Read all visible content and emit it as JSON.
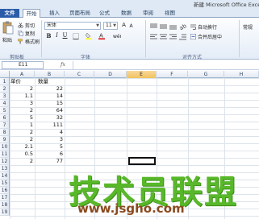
{
  "window": {
    "title": "新建 Microsoft Office Exce"
  },
  "tabs": [
    {
      "label": "文件"
    },
    {
      "label": "开始"
    },
    {
      "label": "插入"
    },
    {
      "label": "页面布局"
    },
    {
      "label": "公式"
    },
    {
      "label": "数据"
    },
    {
      "label": "审阅"
    },
    {
      "label": "视图"
    }
  ],
  "ribbon": {
    "clipboard": {
      "paste": "粘贴",
      "cut": "剪切",
      "copy": "复制",
      "format_painter": "格式刷",
      "group_label": "剪贴板"
    },
    "font": {
      "font_name": "宋体",
      "font_size": "11",
      "bold": "B",
      "italic": "I",
      "underline": "U",
      "group_label": "字体"
    },
    "alignment": {
      "wrap_text": "自动换行",
      "merge_center": "合并后居中",
      "group_label": "对齐方式"
    },
    "number": {
      "format": "常规"
    }
  },
  "formula_bar": {
    "cell_ref": "E11",
    "fx": "fx",
    "value": ""
  },
  "grid": {
    "columns": [
      "A",
      "B",
      "C",
      "D",
      "E",
      "F",
      "G",
      "H"
    ],
    "selected_column": "E",
    "rows": [
      "1",
      "2",
      "3",
      "4",
      "5",
      "6",
      "7",
      "8",
      "9",
      "10",
      "11",
      "12",
      "13",
      "14",
      "15",
      "16",
      "17",
      "18",
      "19"
    ],
    "headers": {
      "A1": "单价",
      "B1": "数量"
    },
    "data": [
      {
        "a": "2",
        "b": "22"
      },
      {
        "a": "1.1",
        "b": "14"
      },
      {
        "a": "3",
        "b": "15"
      },
      {
        "a": "2",
        "b": "64"
      },
      {
        "a": "5",
        "b": "32"
      },
      {
        "a": "1",
        "b": "111"
      },
      {
        "a": "2",
        "b": "4"
      },
      {
        "a": "2",
        "b": "3"
      },
      {
        "a": "2.1",
        "b": "5"
      },
      {
        "a": "0.5",
        "b": "6"
      },
      {
        "a": "2",
        "b": "77"
      }
    ]
  },
  "watermark": {
    "brand": "技术员联盟",
    "url": "www.jsgho.com"
  },
  "colors": {
    "file_tab": "#2a5caa",
    "watermark_green": "#58b82a",
    "watermark_url": "#8a4a1e"
  }
}
